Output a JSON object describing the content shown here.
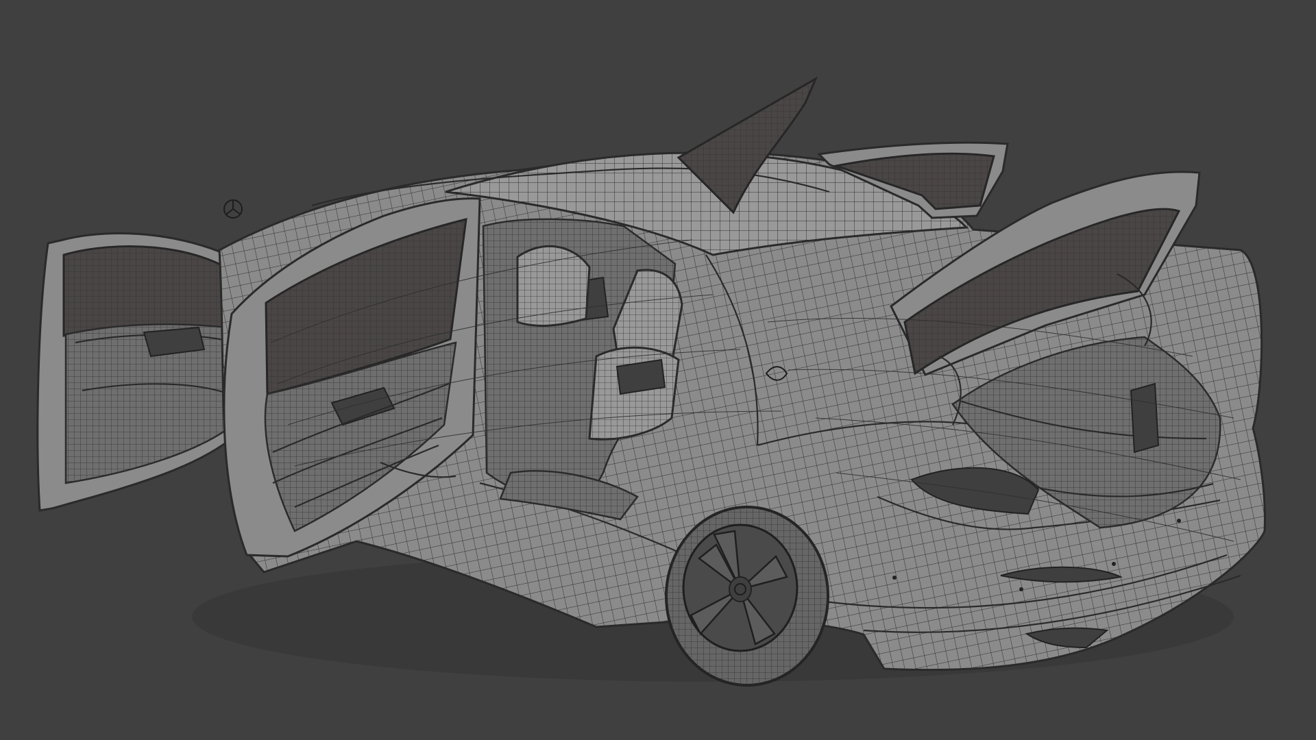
{
  "scene": {
    "background_color": "#404040",
    "model_color": "#8b8b8b",
    "wireframe_color": "#2a2a2a",
    "glass_color": "#4a4645"
  }
}
